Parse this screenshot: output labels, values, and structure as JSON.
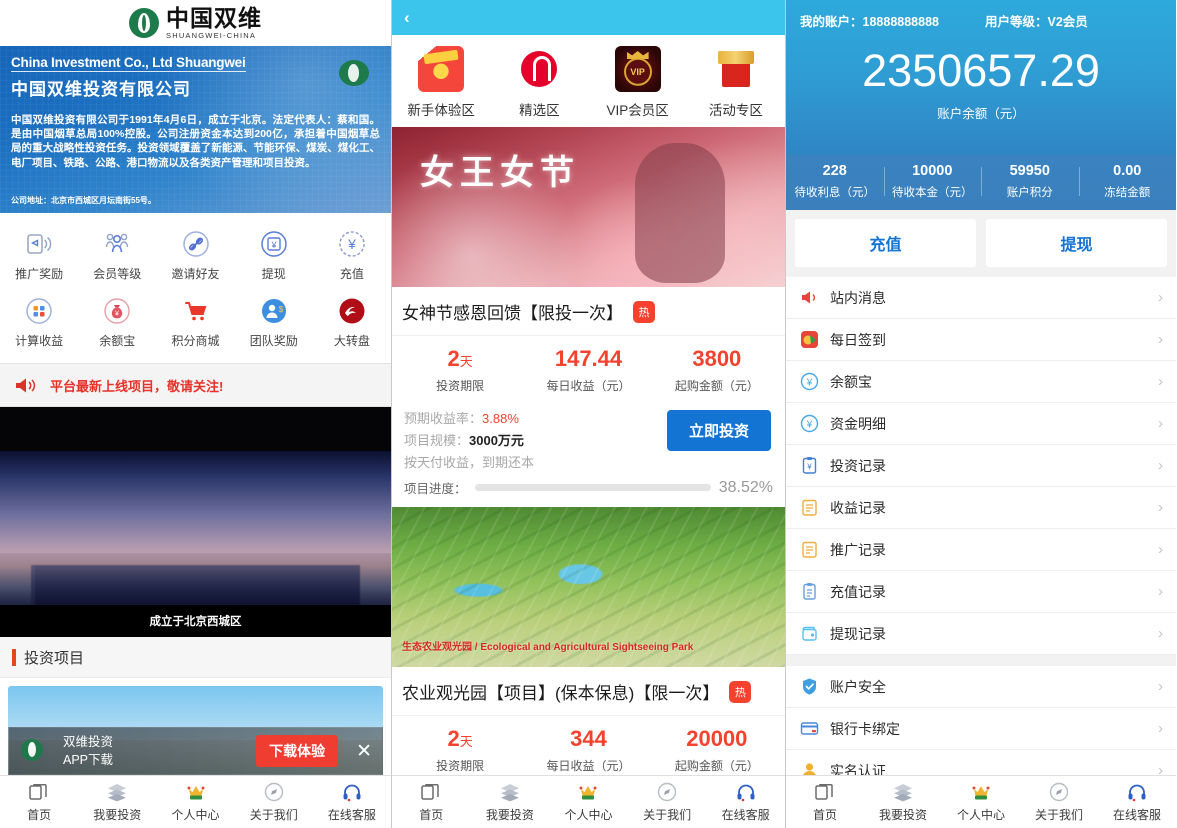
{
  "left": {
    "logo": {
      "cn": "中国双维",
      "en": "SHUANGWEI-CHINA"
    },
    "company": {
      "en_name": "China Investment Co., Ltd Shuangwei",
      "cn_name": "中国双维投资有限公司",
      "body": "中国双维投资有限公司于1991年4月6日，成立于北京。法定代表人：蔡和国。是由中国烟草总局100%控股。公司注册资金本达到200亿，承担着中国烟草总局的重大战略性投资任务。投资领域覆盖了新能源、节能环保、煤炭、煤化工、电厂项目、铁路、公路、港口物流以及各类资产管理和项目投资。",
      "address": "公司地址：北京市西城区月坛南街55号。"
    },
    "quick_grid": [
      {
        "label": "推广奖励",
        "icon": "megaphone-icon"
      },
      {
        "label": "会员等级",
        "icon": "members-icon"
      },
      {
        "label": "邀请好友",
        "icon": "link-icon"
      },
      {
        "label": "提现",
        "icon": "withdraw-icon"
      },
      {
        "label": "充值",
        "icon": "recharge-icon"
      },
      {
        "label": "计算收益",
        "icon": "calculator-icon"
      },
      {
        "label": "余额宝",
        "icon": "money-bag-icon"
      },
      {
        "label": "积分商城",
        "icon": "cart-icon"
      },
      {
        "label": "团队奖励",
        "icon": "team-icon"
      },
      {
        "label": "大转盘",
        "icon": "wheel-icon"
      }
    ],
    "notice": "平台最新上线项目，敬请关注!",
    "hero_caption": "成立于北京西城区",
    "section_title": "投资项目",
    "download_banner": {
      "line1": "双维投资",
      "line2": "APP下载",
      "button": "下载体验",
      "close": "✕"
    },
    "bottom_nav": [
      {
        "label": "首页",
        "icon": "home-icon"
      },
      {
        "label": "我要投资",
        "icon": "layers-icon"
      },
      {
        "label": "个人中心",
        "icon": "crown-icon"
      },
      {
        "label": "关于我们",
        "icon": "compass-icon"
      },
      {
        "label": "在线客服",
        "icon": "headset-icon"
      }
    ]
  },
  "middle": {
    "back": "‹",
    "categories": [
      {
        "label": "新手体验区",
        "icon": "newbie-zone-icon"
      },
      {
        "label": "精选区",
        "icon": "selected-zone-icon"
      },
      {
        "label": "VIP会员区",
        "icon": "vip-zone-icon"
      },
      {
        "label": "活动专区",
        "icon": "activity-zone-icon"
      }
    ],
    "banner_text": "女王女节",
    "projects": [
      {
        "title": "女神节感恩回馈【限投一次】",
        "badge": "热",
        "stats": [
          {
            "value": "2",
            "unit": "天",
            "label": "投资期限"
          },
          {
            "value": "147.44",
            "unit": "",
            "label": "每日收益（元）"
          },
          {
            "value": "3800",
            "unit": "",
            "label": "起购金额（元）"
          }
        ],
        "rate_label": "预期收益率：",
        "rate_value": "3.88%",
        "scale_label": "项目规模：",
        "scale_value": "3000万元",
        "terms": "按天付收益，到期还本",
        "progress_label": "项目进度：",
        "progress_pct": "38.52%",
        "progress_value": 38.52,
        "cta": "立即投资"
      },
      {
        "title": "农业观光园【项目】(保本保息)【限一次】",
        "badge": "热",
        "photo_caption": "生态农业观光园 / Ecological and Agricultural Sightseeing Park",
        "stats": [
          {
            "value": "2",
            "unit": "天",
            "label": "投资期限"
          },
          {
            "value": "344",
            "unit": "",
            "label": "每日收益（元）"
          },
          {
            "value": "20000",
            "unit": "",
            "label": "起购金额（元）"
          }
        ]
      }
    ],
    "bottom_nav": [
      {
        "label": "首页",
        "icon": "home-icon"
      },
      {
        "label": "我要投资",
        "icon": "layers-icon"
      },
      {
        "label": "个人中心",
        "icon": "crown-icon"
      },
      {
        "label": "关于我们",
        "icon": "compass-icon"
      },
      {
        "label": "在线客服",
        "icon": "headset-icon"
      }
    ]
  },
  "right": {
    "account_label": "我的账户：",
    "account_value": "18888888888",
    "level_label": "用户等级：",
    "level_value": "V2会员",
    "balance": "2350657.29",
    "balance_label": "账户余额（元）",
    "stats": [
      {
        "value": "228",
        "label": "待收利息（元）"
      },
      {
        "value": "10000",
        "label": "待收本金（元）"
      },
      {
        "value": "59950",
        "label": "账户积分"
      },
      {
        "value": "0.00",
        "label": "冻结金额"
      }
    ],
    "actions": [
      {
        "label": "充值"
      },
      {
        "label": "提现"
      }
    ],
    "menu_group_1": [
      {
        "label": "站内消息",
        "icon": "speaker-icon"
      },
      {
        "label": "每日签到",
        "icon": "checkin-icon"
      },
      {
        "label": "余额宝",
        "icon": "yuan-circle-icon"
      },
      {
        "label": "资金明细",
        "icon": "yuan-circle-icon"
      },
      {
        "label": "投资记录",
        "icon": "clipboard-yuan-icon"
      },
      {
        "label": "收益记录",
        "icon": "note-orange-icon"
      },
      {
        "label": "推广记录",
        "icon": "note-orange-icon"
      },
      {
        "label": "充值记录",
        "icon": "clipboard-blue-icon"
      },
      {
        "label": "提现记录",
        "icon": "wallet-icon"
      }
    ],
    "menu_group_2": [
      {
        "label": "账户安全",
        "icon": "shield-icon"
      },
      {
        "label": "银行卡绑定",
        "icon": "bankcard-icon"
      },
      {
        "label": "实名认证",
        "icon": "idcard-icon"
      }
    ],
    "chevron": "›",
    "bottom_nav": [
      {
        "label": "首页",
        "icon": "home-icon"
      },
      {
        "label": "我要投资",
        "icon": "layers-icon"
      },
      {
        "label": "个人中心",
        "icon": "crown-icon"
      },
      {
        "label": "关于我们",
        "icon": "compass-icon"
      },
      {
        "label": "在线客服",
        "icon": "headset-icon"
      }
    ]
  },
  "colors": {
    "brand_green": "#1d7a4a",
    "accent_red": "#f5422e",
    "accent_blue": "#1374d4",
    "header_cyan": "#3bc4ec",
    "header_blue": "#2f9ed4"
  }
}
